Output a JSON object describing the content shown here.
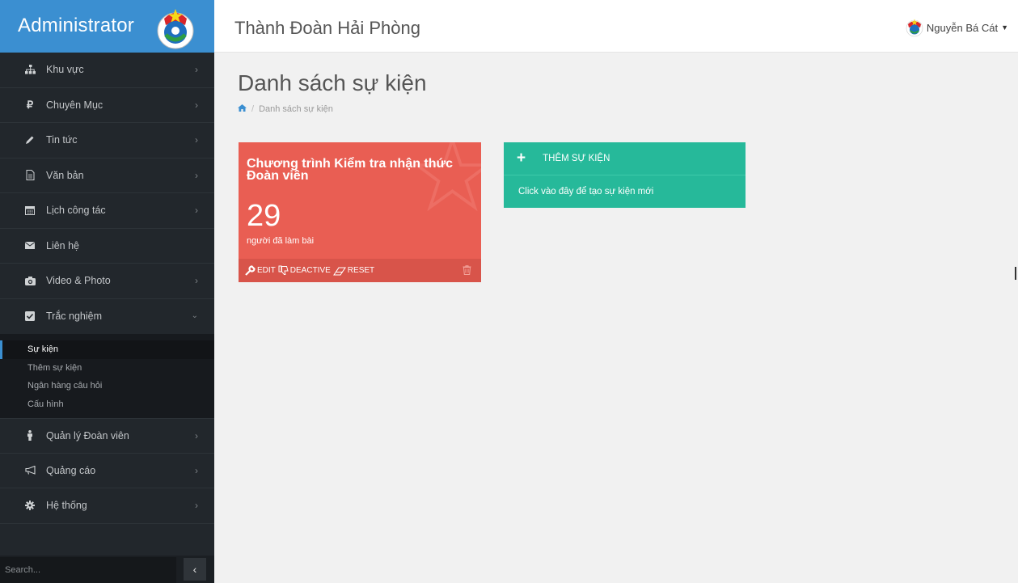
{
  "brand": {
    "title": "Administrator",
    "site_title": "Thành Đoàn Hải Phòng"
  },
  "user": {
    "name": "Nguyễn Bá Cát"
  },
  "colors": {
    "brand_blue": "#3b8fd1",
    "sidebar_bg": "#22272c",
    "event_red": "#e95e53",
    "add_green": "#26b99a"
  },
  "sidebar": {
    "items_top": [
      {
        "label": "Khu vực",
        "icon": "sitemap-icon",
        "has_chevron": true
      },
      {
        "label": "Chuyên Mục",
        "icon": "ruble-icon",
        "has_chevron": true
      },
      {
        "label": "Tin tức",
        "icon": "pencil-icon",
        "has_chevron": true
      },
      {
        "label": "Văn bản",
        "icon": "document-icon",
        "has_chevron": true
      },
      {
        "label": "Lịch công tác",
        "icon": "calendar-icon",
        "has_chevron": true
      },
      {
        "label": "Liên hệ",
        "icon": "envelope-icon",
        "has_chevron": false
      },
      {
        "label": "Video & Photo",
        "icon": "camera-icon",
        "has_chevron": true
      },
      {
        "label": "Trắc nghiệm",
        "icon": "check-square-icon",
        "has_chevron": true,
        "expanded": true
      }
    ],
    "submenu": [
      {
        "label": "Sự kiện",
        "active": true
      },
      {
        "label": "Thêm sự kiện",
        "active": false
      },
      {
        "label": "Ngân hàng câu hỏi",
        "active": false
      },
      {
        "label": "Cấu hình",
        "active": false
      }
    ],
    "items_bottom": [
      {
        "label": "Quản lý Đoàn viên",
        "icon": "person-icon",
        "has_chevron": true
      },
      {
        "label": "Quảng cáo",
        "icon": "bullhorn-icon",
        "has_chevron": true
      },
      {
        "label": "Hệ thống",
        "icon": "cog-icon",
        "has_chevron": true
      }
    ],
    "search_placeholder": "Search..."
  },
  "main": {
    "page_title": "Danh sách sự kiện",
    "breadcrumb": [
      "Danh sách sự kiện"
    ]
  },
  "event_card": {
    "title": "Chương trình Kiểm tra nhận thức Đoàn viên",
    "count": "29",
    "count_label": "người đã làm bài",
    "actions": {
      "edit": "EDIT",
      "deactive": "DEACTIVE",
      "reset": "RESET"
    }
  },
  "add_card": {
    "title": "THÊM SỰ KIỆN",
    "description": "Click vào đây để tạo sự kiện mới"
  }
}
